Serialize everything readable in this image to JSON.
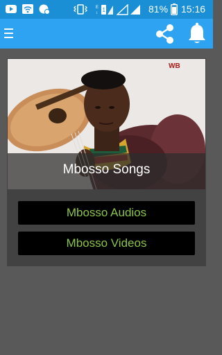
{
  "status_bar": {
    "battery": "81%",
    "time": "15:16",
    "icons": [
      "youtube-icon",
      "wifi-icon",
      "chat-icon",
      "vibrate-icon",
      "sim1-signal-icon",
      "sim2-signal-icon",
      "battery-icon"
    ]
  },
  "app_bar": {
    "icons": [
      "menu-icon",
      "share-icon",
      "bell-icon"
    ]
  },
  "hero": {
    "title": "Mbosso Songs"
  },
  "buttons": {
    "audios": "Mbosso Audios",
    "videos": "Mbosso Videos"
  },
  "colors": {
    "status_bar": "#1a8fd6",
    "app_bar": "#2ea3f2",
    "background": "#595959",
    "card": "#424242",
    "button_text": "#8bc34a"
  }
}
